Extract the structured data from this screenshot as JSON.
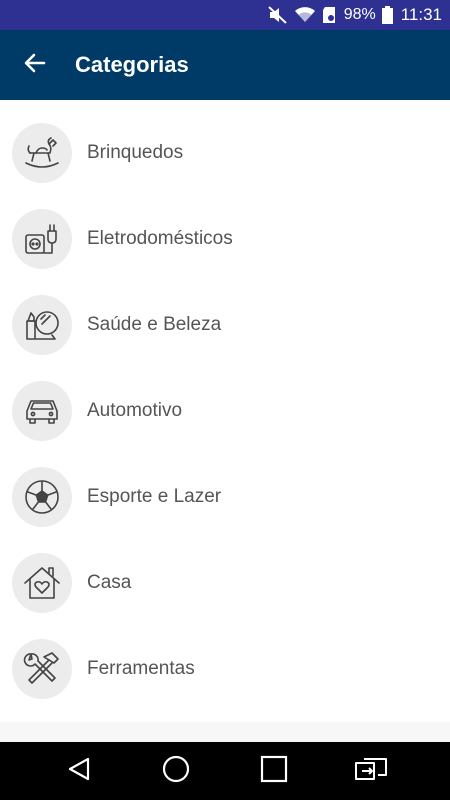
{
  "status_bar": {
    "battery": "98%",
    "time": "11:31",
    "icons": [
      "mute-icon",
      "wifi-icon",
      "sd-card-icon",
      "battery-icon"
    ]
  },
  "app_bar": {
    "title": "Categorias",
    "back_icon": "arrow-left-icon"
  },
  "categories": [
    {
      "label": "Brinquedos",
      "icon": "rocking-horse-icon"
    },
    {
      "label": "Eletrodomésticos",
      "icon": "plug-outlet-icon"
    },
    {
      "label": "Saúde e Beleza",
      "icon": "lipstick-mirror-icon"
    },
    {
      "label": "Automotivo",
      "icon": "car-icon"
    },
    {
      "label": "Esporte e Lazer",
      "icon": "soccer-ball-icon"
    },
    {
      "label": "Casa",
      "icon": "house-heart-icon"
    },
    {
      "label": "Ferramentas",
      "icon": "wrench-hammer-icon"
    }
  ],
  "nav_bar": {
    "buttons": [
      "back-triangle-icon",
      "home-circle-icon",
      "recents-square-icon",
      "switch-icon"
    ]
  },
  "colors": {
    "status_bar": "#2e3192",
    "app_bar": "#003a66",
    "icon_bg": "#ececec",
    "label_text": "#555555"
  }
}
